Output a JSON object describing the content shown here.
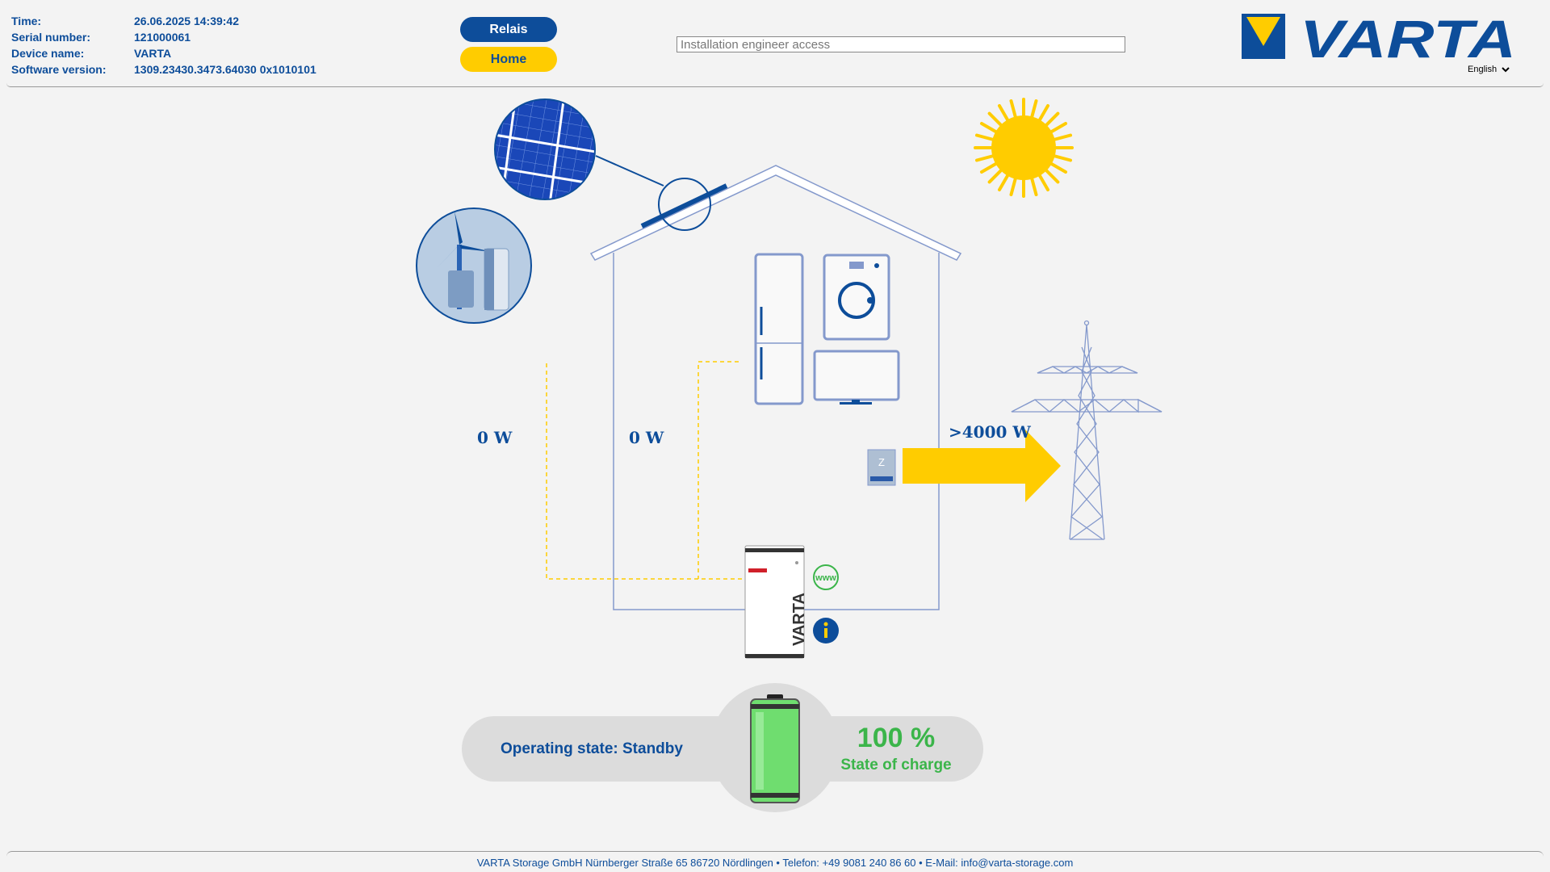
{
  "info": {
    "time_label": "Time:",
    "time_value": "26.06.2025 14:39:42",
    "serial_label": "Serial number:",
    "serial_value": "121000061",
    "device_label": "Device name:",
    "device_value": "VARTA",
    "software_label": "Software version:",
    "software_value": "1309.23430.3473.64030 0x1010101"
  },
  "buttons": {
    "relais": "Relais",
    "home": "Home"
  },
  "search": {
    "placeholder": "Installation engineer access",
    "value": ""
  },
  "logo": {
    "text": "VARTA"
  },
  "language": {
    "selected": "English"
  },
  "power": {
    "left": "0 W",
    "middle": "0 W",
    "grid": ">4000 W"
  },
  "battery_device": {
    "brand": "VARTA"
  },
  "status": {
    "operating_state": "Operating state: Standby",
    "soc_value": "100 %",
    "soc_label": "State of charge"
  },
  "icons": {
    "www": "www",
    "meter": "Z"
  },
  "footer": {
    "text": "VARTA Storage GmbH Nürnberger Straße 65 86720 Nördlingen • Telefon: +49 9081 240 86 60 • E-Mail: info@varta-storage.com"
  },
  "colors": {
    "brand_blue": "#0d4d9a",
    "brand_yellow": "#ffcc00",
    "soc_green": "#3bb54a"
  }
}
